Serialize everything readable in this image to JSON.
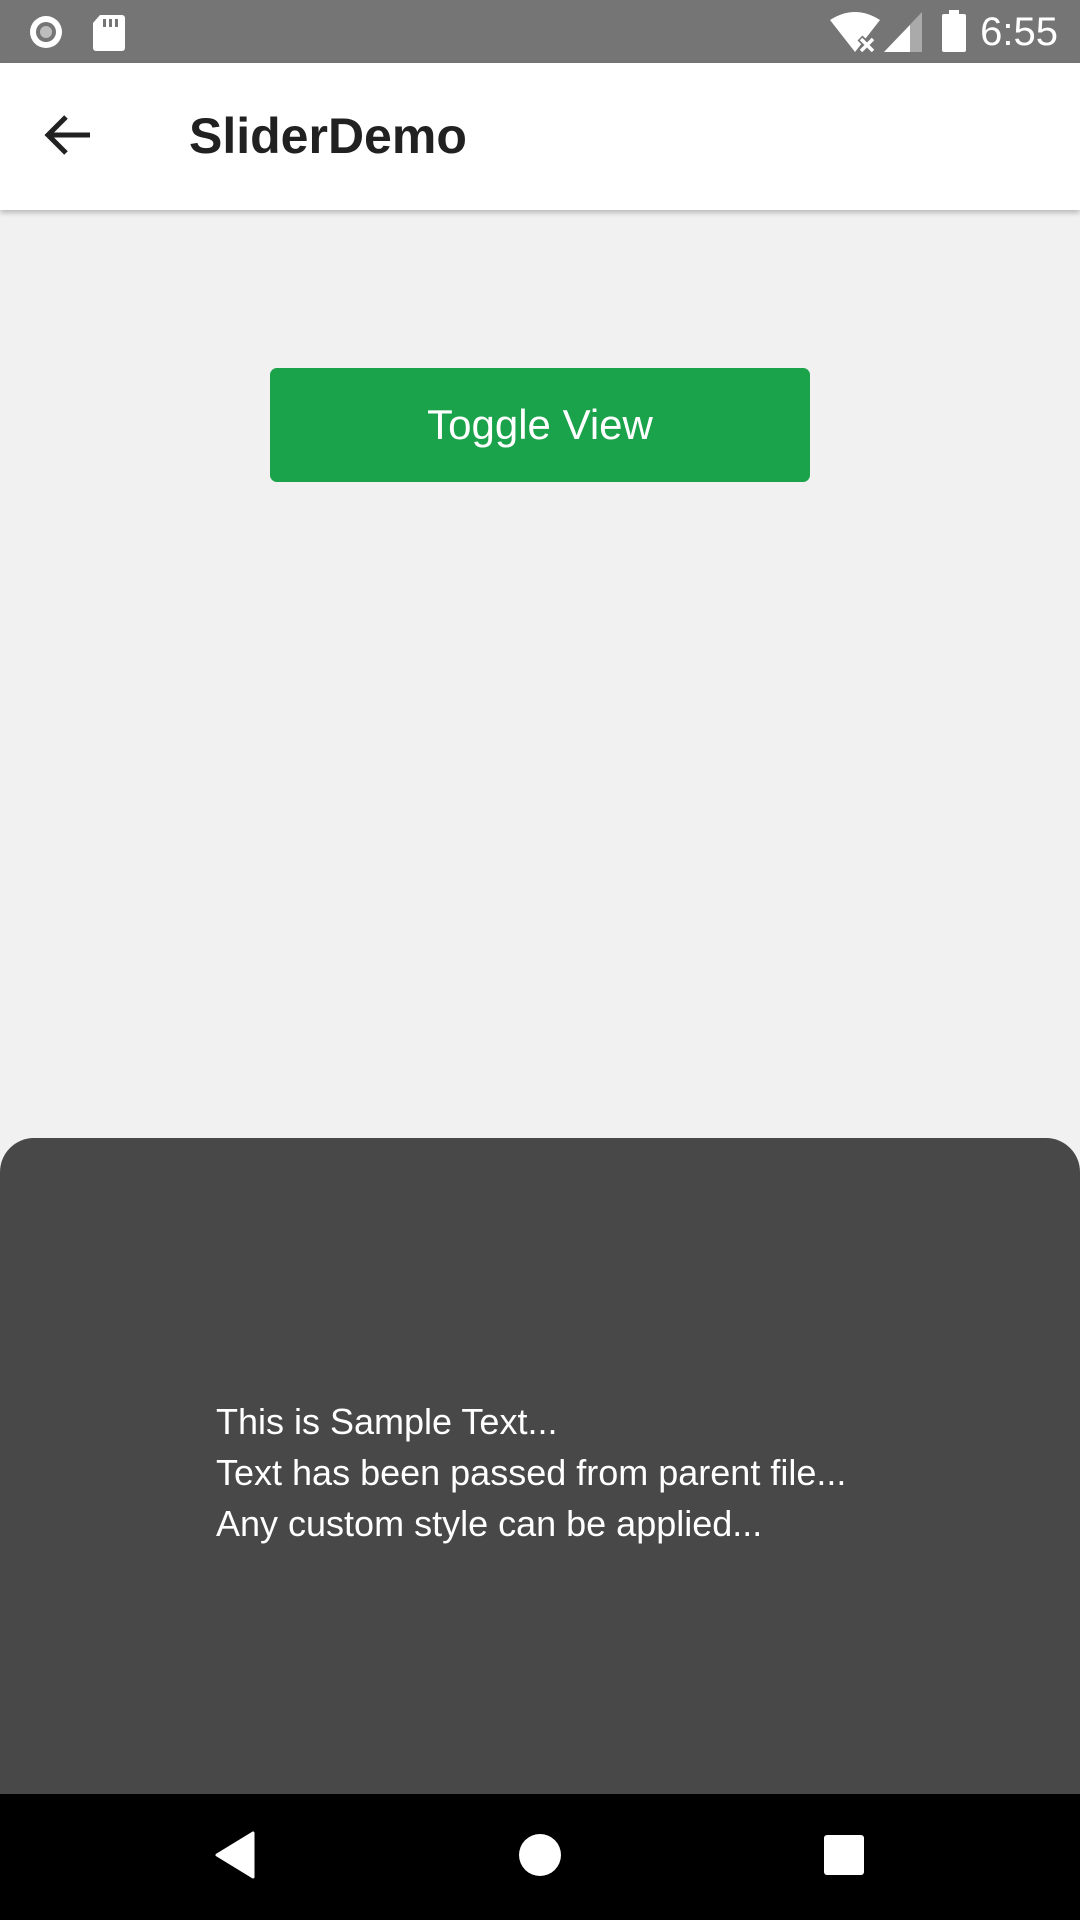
{
  "status_bar": {
    "time": "6:55",
    "icons": [
      "record-icon",
      "sd-card-icon",
      "wifi-no-internet-icon",
      "cell-signal-icon",
      "battery-icon"
    ]
  },
  "app_bar": {
    "back_icon": "arrow-back-icon",
    "title": "SliderDemo"
  },
  "main": {
    "toggle_button_label": "Toggle View",
    "toggle_button_color": "#1aa34a"
  },
  "sheet": {
    "background": "#484848",
    "lines": [
      "This is Sample Text...",
      "Text has been passed from parent file...",
      "Any custom style can be applied..."
    ]
  },
  "nav_bar": {
    "buttons": [
      "back-triangle-icon",
      "home-circle-icon",
      "recents-square-icon"
    ]
  }
}
